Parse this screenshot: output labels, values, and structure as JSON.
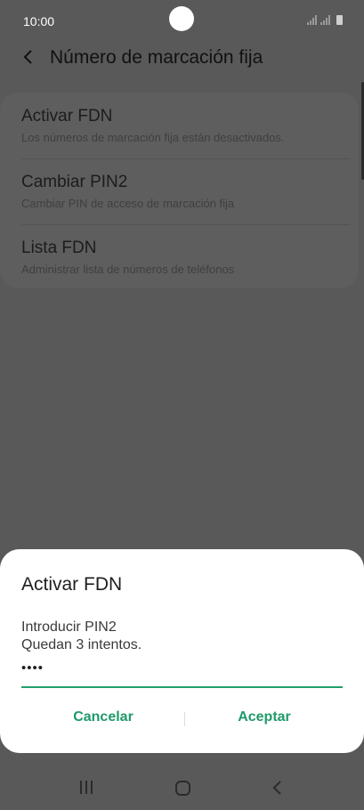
{
  "status_bar": {
    "time": "10:00"
  },
  "header": {
    "title": "Número de marcación fija"
  },
  "settings": {
    "items": [
      {
        "title": "Activar FDN",
        "subtitle": "Los números de marcación fija están desactivados."
      },
      {
        "title": "Cambiar PIN2",
        "subtitle": "Cambiar PIN de acceso de marcación fija"
      },
      {
        "title": "Lista FDN",
        "subtitle": "Administrar lista de números de teléfonos"
      }
    ]
  },
  "dialog": {
    "title": "Activar FDN",
    "message_line1": "Introducir PIN2",
    "message_line2": "Quedan 3 intentos.",
    "pin_value": "••••",
    "cancel_label": "Cancelar",
    "accept_label": "Aceptar"
  },
  "colors": {
    "accent": "#1f9a6a",
    "scrim": "#595959"
  },
  "icons": {
    "back": "back-arrow-icon",
    "recents": "recents-icon",
    "home": "home-icon",
    "nav_back": "nav-back-icon"
  }
}
